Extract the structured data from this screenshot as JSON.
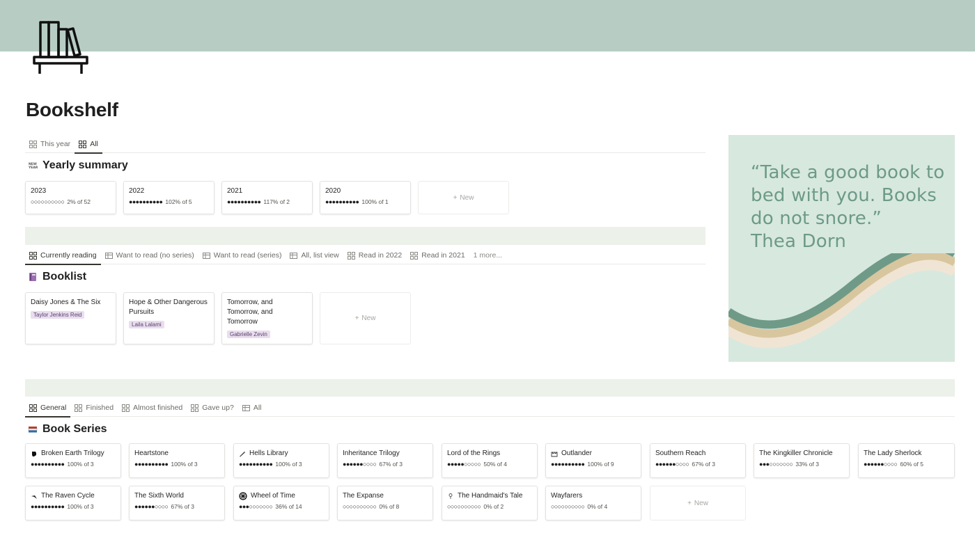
{
  "page": {
    "title": "Bookshelf",
    "icon": "bookshelf-icon",
    "cover_color": "#b7cdc4"
  },
  "yearly": {
    "tabs": [
      {
        "label": "This year",
        "icon": "gallery-icon",
        "active": false
      },
      {
        "label": "All",
        "icon": "gallery-icon",
        "active": true
      }
    ],
    "title": "Yearly summary",
    "icon": "new-year-icon",
    "cards": [
      {
        "year": "2023",
        "dots": "○○○○○○○○○○",
        "text": "2% of 52"
      },
      {
        "year": "2022",
        "dots": "●●●●●●●●●●",
        "text": "102% of 5"
      },
      {
        "year": "2021",
        "dots": "●●●●●●●●●●",
        "text": "117% of 2"
      },
      {
        "year": "2020",
        "dots": "●●●●●●●●●●",
        "text": "100% of 1"
      }
    ],
    "new_label": "New"
  },
  "booklist": {
    "tabs": [
      {
        "label": "Currently reading",
        "icon": "gallery-icon",
        "active": true
      },
      {
        "label": "Want to read (no series)",
        "icon": "table-icon",
        "active": false
      },
      {
        "label": "Want to read (series)",
        "icon": "table-icon",
        "active": false
      },
      {
        "label": "All, list view",
        "icon": "table-icon",
        "active": false
      },
      {
        "label": "Read in 2022",
        "icon": "gallery-icon",
        "active": false
      },
      {
        "label": "Read in 2021",
        "icon": "gallery-icon",
        "active": false
      }
    ],
    "more_label": "1 more...",
    "title": "Booklist",
    "icon": "purple-book-icon",
    "cards": [
      {
        "title": "Daisy Jones & The Six",
        "author": "Taylor Jenkins Reid"
      },
      {
        "title": "Hope & Other Dangerous Pursuits",
        "author": "Laila Lalami"
      },
      {
        "title": "Tomorrow, and Tomorrow, and Tomorrow",
        "author": "Gabrielle Zevin"
      }
    ],
    "new_label": "New"
  },
  "quote": {
    "text": "“Take a good book to bed with you. Books do not snore.”",
    "author": "Thea Dorn",
    "bg_color": "#d7e8df",
    "text_color": "#6d9a87"
  },
  "series": {
    "tabs": [
      {
        "label": "General",
        "icon": "gallery-icon",
        "active": true
      },
      {
        "label": "Finished",
        "icon": "gallery-icon",
        "active": false
      },
      {
        "label": "Almost finished",
        "icon": "gallery-icon",
        "active": false
      },
      {
        "label": "Gave up?",
        "icon": "gallery-icon",
        "active": false
      },
      {
        "label": "All",
        "icon": "table-icon",
        "active": false
      }
    ],
    "title": "Book Series",
    "icon": "books-icon",
    "cards": [
      {
        "title": "Broken Earth Trilogy",
        "icon": "fist-icon",
        "dots": "●●●●●●●●●●",
        "text": "100% of 3"
      },
      {
        "title": "Heartstone",
        "icon": "",
        "dots": "●●●●●●●●●●",
        "text": "100% of 3"
      },
      {
        "title": "Hells Library",
        "icon": "quill-icon",
        "dots": "●●●●●●●●●●",
        "text": "100% of 3"
      },
      {
        "title": "Inheritance Trilogy",
        "icon": "",
        "dots": "●●●●●●○○○○",
        "text": "67% of 3"
      },
      {
        "title": "Lord of the Rings",
        "icon": "",
        "dots": "●●●●●○○○○○",
        "text": "50% of 4"
      },
      {
        "title": "Outlander",
        "icon": "castle-icon",
        "dots": "●●●●●●●●●●",
        "text": "100% of 9"
      },
      {
        "title": "Southern Reach",
        "icon": "",
        "dots": "●●●●●●○○○○",
        "text": "67% of 3"
      },
      {
        "title": "The Kingkiller Chronicle",
        "icon": "",
        "dots": "●●●○○○○○○○",
        "text": "33% of 3"
      },
      {
        "title": "The Lady Sherlock",
        "icon": "",
        "dots": "●●●●●●○○○○",
        "text": "60% of 5"
      },
      {
        "title": "The Raven Cycle",
        "icon": "raven-icon",
        "dots": "●●●●●●●●●●",
        "text": "100% of 3"
      },
      {
        "title": "The Sixth World",
        "icon": "",
        "dots": "●●●●●●○○○○",
        "text": "67% of 3"
      },
      {
        "title": "Wheel of Time",
        "icon": "wheel-icon",
        "dots": "●●●○○○○○○○",
        "text": "36% of 14"
      },
      {
        "title": "The Expanse",
        "icon": "",
        "dots": "○○○○○○○○○○",
        "text": "0% of 8"
      },
      {
        "title": "The Handmaid's Tale",
        "icon": "pin-icon",
        "dots": "○○○○○○○○○○",
        "text": "0% of 2"
      },
      {
        "title": "Wayfarers",
        "icon": "",
        "dots": "○○○○○○○○○○",
        "text": "0% of 4"
      }
    ],
    "new_label": "New"
  }
}
